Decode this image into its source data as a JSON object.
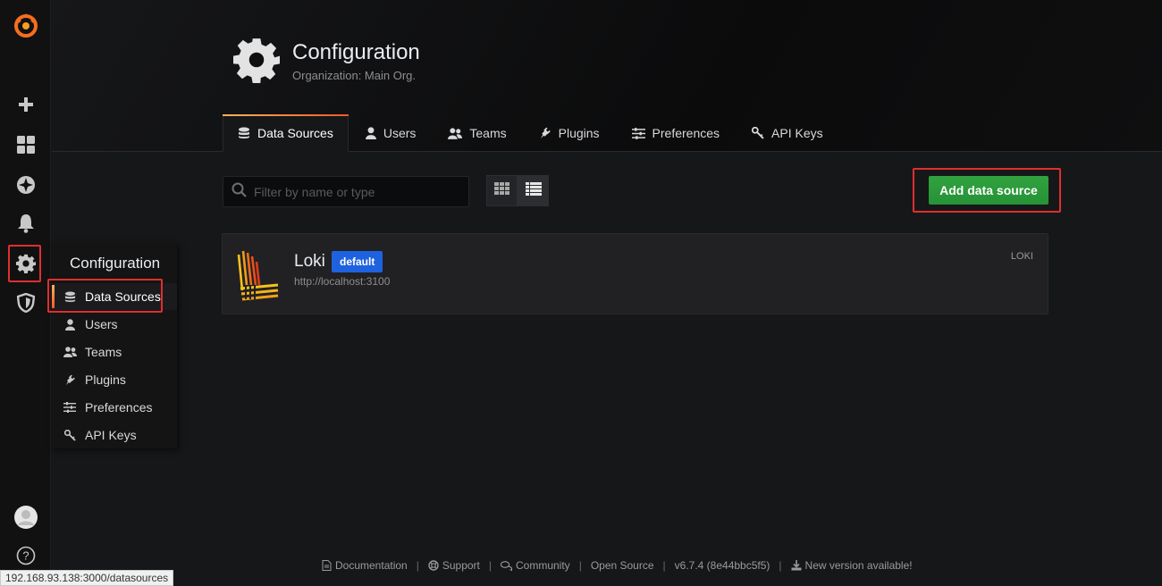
{
  "app": {
    "title": "Grafana"
  },
  "sidebar": {
    "icons": [
      "grafana-logo",
      "plus-icon",
      "dashboards-icon",
      "explore-icon",
      "alerting-icon",
      "configuration-gear-icon",
      "server-admin-shield-icon",
      "user-avatar",
      "help-icon"
    ]
  },
  "flyout": {
    "title": "Configuration",
    "items": [
      {
        "label": "Data Sources",
        "icon": "database-icon",
        "active": true
      },
      {
        "label": "Users",
        "icon": "user-icon"
      },
      {
        "label": "Teams",
        "icon": "users-icon"
      },
      {
        "label": "Plugins",
        "icon": "plug-icon"
      },
      {
        "label": "Preferences",
        "icon": "sliders-icon"
      },
      {
        "label": "API Keys",
        "icon": "key-icon"
      }
    ]
  },
  "header": {
    "title": "Configuration",
    "subtitle": "Organization: Main Org."
  },
  "tabs": [
    {
      "label": "Data Sources",
      "icon": "database-icon",
      "active": true
    },
    {
      "label": "Users",
      "icon": "user-icon"
    },
    {
      "label": "Teams",
      "icon": "users-icon"
    },
    {
      "label": "Plugins",
      "icon": "plug-icon"
    },
    {
      "label": "Preferences",
      "icon": "sliders-icon"
    },
    {
      "label": "API Keys",
      "icon": "key-icon"
    }
  ],
  "toolbar": {
    "search_placeholder": "Filter by name or type",
    "add_button_label": "Add data source",
    "view_mode": "list"
  },
  "datasources": [
    {
      "name": "Loki",
      "badge": "default",
      "url": "http://localhost:3100",
      "type": "LOKI"
    }
  ],
  "footer": {
    "documentation": "Documentation",
    "support": "Support",
    "community": "Community",
    "open_source": "Open Source",
    "version": "v6.7.4 (8e44bbc5f5)",
    "new_version": "New version available!"
  },
  "status_bar": {
    "url": "192.168.93.138:3000/datasources"
  },
  "colors": {
    "highlight": "#e02f2f",
    "primary_button": "#299c39",
    "badge": "#1f62e0",
    "active_tab_accent": "#f05a28"
  }
}
